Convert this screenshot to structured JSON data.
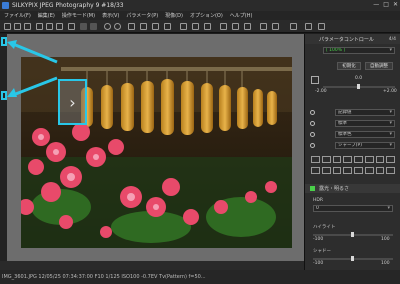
{
  "window": {
    "title": "SILKYPIX JPEG Photography 9    #18/33",
    "controls": [
      "—",
      "□",
      "✕"
    ]
  },
  "menu": [
    "ファイル(F)",
    "編集(E)",
    "操作モード(M)",
    "表示(V)",
    "パラメータ(P)",
    "現像(D)",
    "オプション(O)",
    "ヘルプ(H)"
  ],
  "panel": {
    "title": "パラメータコントロール",
    "page_indicator": "4/4",
    "preset_value": "[ 100% ]",
    "buttons": {
      "initial": "初期化",
      "auto": "自動調整"
    },
    "exposure": {
      "value": "0.0",
      "min": "-2.00",
      "max": "+2.00"
    },
    "rows": [
      {
        "icon": "wb-icon",
        "label": "",
        "value": "記録値"
      },
      {
        "icon": "tone-icon",
        "label": "",
        "value": "標準"
      },
      {
        "icon": "color-icon",
        "label": "",
        "value": "標準色"
      },
      {
        "icon": "sharp-icon",
        "label": "",
        "value": "シャープ(P)"
      }
    ],
    "section": "露光・明るさ",
    "hdr": {
      "label": "HDR",
      "value": "0"
    },
    "highlight": {
      "label": "ハイライト",
      "min": "-100",
      "max": "100"
    },
    "shadow": {
      "label": "シャドー",
      "min": "-100",
      "max": "100"
    }
  },
  "viewer": {
    "nav_arrow": "›"
  },
  "status": {
    "text": "IMG_3601.JPG 12/05/25 07:34:37:00 F10 1/125 ISO100 -0.7EV Tv(Pattern) f=50..."
  }
}
